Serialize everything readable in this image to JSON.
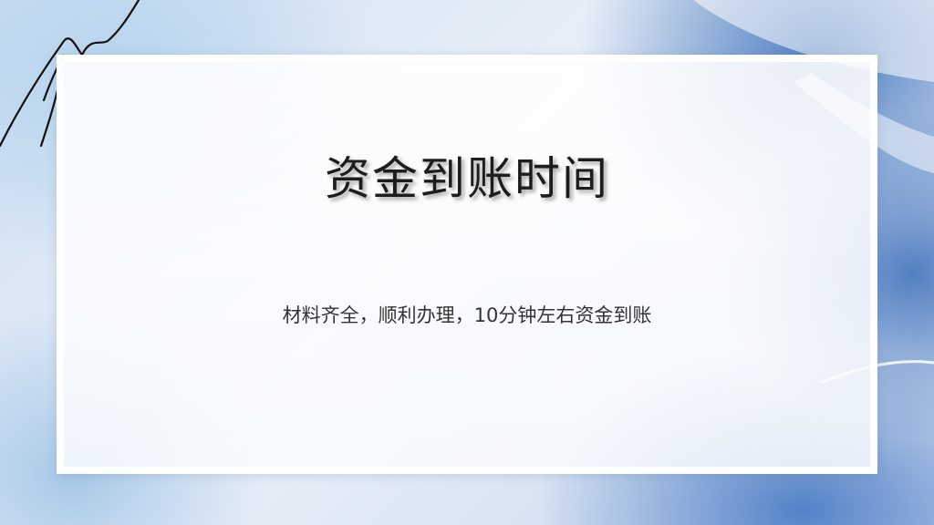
{
  "slide": {
    "title": "资金到账时间",
    "subtitle": "材料齐全，顺利办理，10分钟左右资金到账"
  },
  "colors": {
    "accent_blue": "#3f6fb8",
    "light_blue": "#b0d0ec",
    "card_white": "#ffffff",
    "title_text": "#1d1d1d",
    "body_text": "#333333"
  },
  "decorations": {
    "brush_stroke": "ink-scribble-decoration",
    "watercolor": "watercolor-wash-decoration"
  }
}
